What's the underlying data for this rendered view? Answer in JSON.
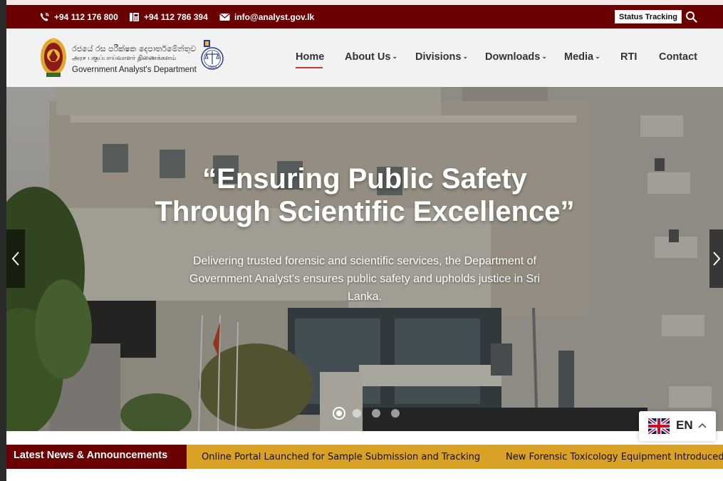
{
  "topbar": {
    "phone": "+94 112 176 800",
    "fax": "+94 112 786 394",
    "email": "info@analyst.gov.lk",
    "status_button": "Status Tracking",
    "colors": {
      "background": "#6b0000"
    }
  },
  "logo": {
    "line_sinhala": "රජයේ රස පරීක්ෂක දෙපාර්තමේන්තුව",
    "line_tamil": "அரச பகுப்பாய்வாளர் திணைக்களம்",
    "line_english": "Government Analyst's Department",
    "emblem_year": "1904"
  },
  "nav": {
    "items": [
      {
        "label": "Home",
        "active": true,
        "dropdown": false
      },
      {
        "label": "About Us",
        "active": false,
        "dropdown": true
      },
      {
        "label": "Divisions",
        "active": false,
        "dropdown": true
      },
      {
        "label": "Downloads",
        "active": false,
        "dropdown": true
      },
      {
        "label": "Media",
        "active": false,
        "dropdown": true
      },
      {
        "label": "RTI",
        "active": false,
        "dropdown": false
      },
      {
        "label": "Contact",
        "active": false,
        "dropdown": false
      }
    ],
    "dropdown_glyph": "⌄",
    "active_color": "#c0392b"
  },
  "hero": {
    "title_line1": "“Ensuring Public Safety",
    "title_line2": "Through Scientific Excellence”",
    "subtitle": "Delivering trusted forensic and scientific services, the Department of Government Analyst's ensures public safety and upholds justice in Sri Lanka.",
    "slides": 4,
    "active_slide": 1,
    "prev_icon": "chevron-left-icon",
    "next_icon": "chevron-right-icon"
  },
  "news": {
    "label": "Latest News & Announcements",
    "items": [
      "Online Portal Launched for Sample Submission and Tracking",
      "New Forensic Toxicology Equipment Introduced"
    ],
    "colors": {
      "label_bg": "#6b0000",
      "ticker_bg": "#d9a126"
    }
  },
  "language": {
    "code": "EN",
    "flag": "uk-flag-icon"
  }
}
